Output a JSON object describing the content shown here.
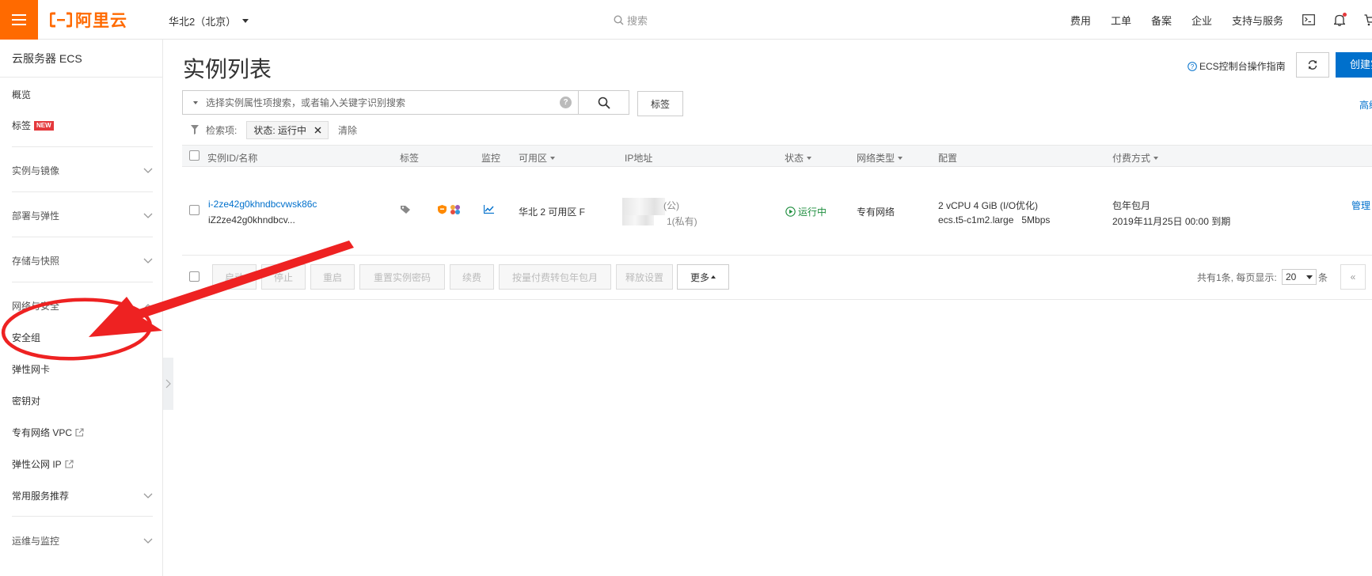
{
  "topbar": {
    "brand": "阿里云",
    "region": "华北2（北京）",
    "search_placeholder": "搜索",
    "links": [
      "费用",
      "工单",
      "备案",
      "企业",
      "支持与服务"
    ]
  },
  "sidebar": {
    "title": "云服务器 ECS",
    "overview": "概览",
    "tags": "标签",
    "new_badge": "NEW",
    "groups": {
      "instances_images": "实例与镜像",
      "deploy_elastic": "部署与弹性",
      "storage_snapshots": "存储与快照",
      "network_security": "网络与安全",
      "common_services": "常用服务推荐",
      "ops_monitoring": "运维与监控"
    },
    "network_items": {
      "security_group": "安全组",
      "eni": "弹性网卡",
      "keypair": "密钥对",
      "vpc": "专有网络 VPC",
      "eip": "弹性公网 IP"
    }
  },
  "main": {
    "title": "实例列表",
    "help_link": "ECS控制台操作指南",
    "create_button": "创建实例",
    "advanced_search": "高级",
    "search_placeholder": "选择实例属性项搜索，或者输入关键字识别搜索",
    "tag_button": "标签",
    "filter_label": "检索项:",
    "filter_chip": "状态: 运行中",
    "clear_filter": "清除"
  },
  "table": {
    "columns": {
      "id_name": "实例ID/名称",
      "tags": "标签",
      "monitor": "监控",
      "zone": "可用区",
      "ip": "IP地址",
      "status": "状态",
      "network_type": "网络类型",
      "config": "配置",
      "billing": "付费方式"
    },
    "rows": [
      {
        "instance_id": "i-2ze42g0khndbcvwsk86c",
        "instance_name": "iZ2ze42g0khndbcv...",
        "zone": "华北 2 可用区 F",
        "ip_public": "(公)",
        "ip_private": "1(私有)",
        "status": "运行中",
        "network_type": "专有网络",
        "config_line1": "2 vCPU 4 GiB (I/O优化)",
        "config_line2": "ecs.t5-c1m2.large   5Mbps",
        "billing_type": "包年包月",
        "expire": "2019年11月25日 00:00 到期",
        "manage": "管理"
      }
    ]
  },
  "actions": {
    "start": "启动",
    "stop": "停止",
    "restart": "重启",
    "reset_password": "重置实例密码",
    "renew": "续费",
    "convert_billing": "按量付费转包年包月",
    "release_settings": "释放设置",
    "more": "更多"
  },
  "pagination": {
    "summary": "共有1条, 每页显示:",
    "page_size": "20",
    "unit": "条",
    "prev": "«"
  },
  "colors": {
    "brand_orange": "#ff6a00",
    "primary_blue": "#0070cc",
    "running_green": "#1e8e3e",
    "annotation_red": "#ee2222"
  }
}
